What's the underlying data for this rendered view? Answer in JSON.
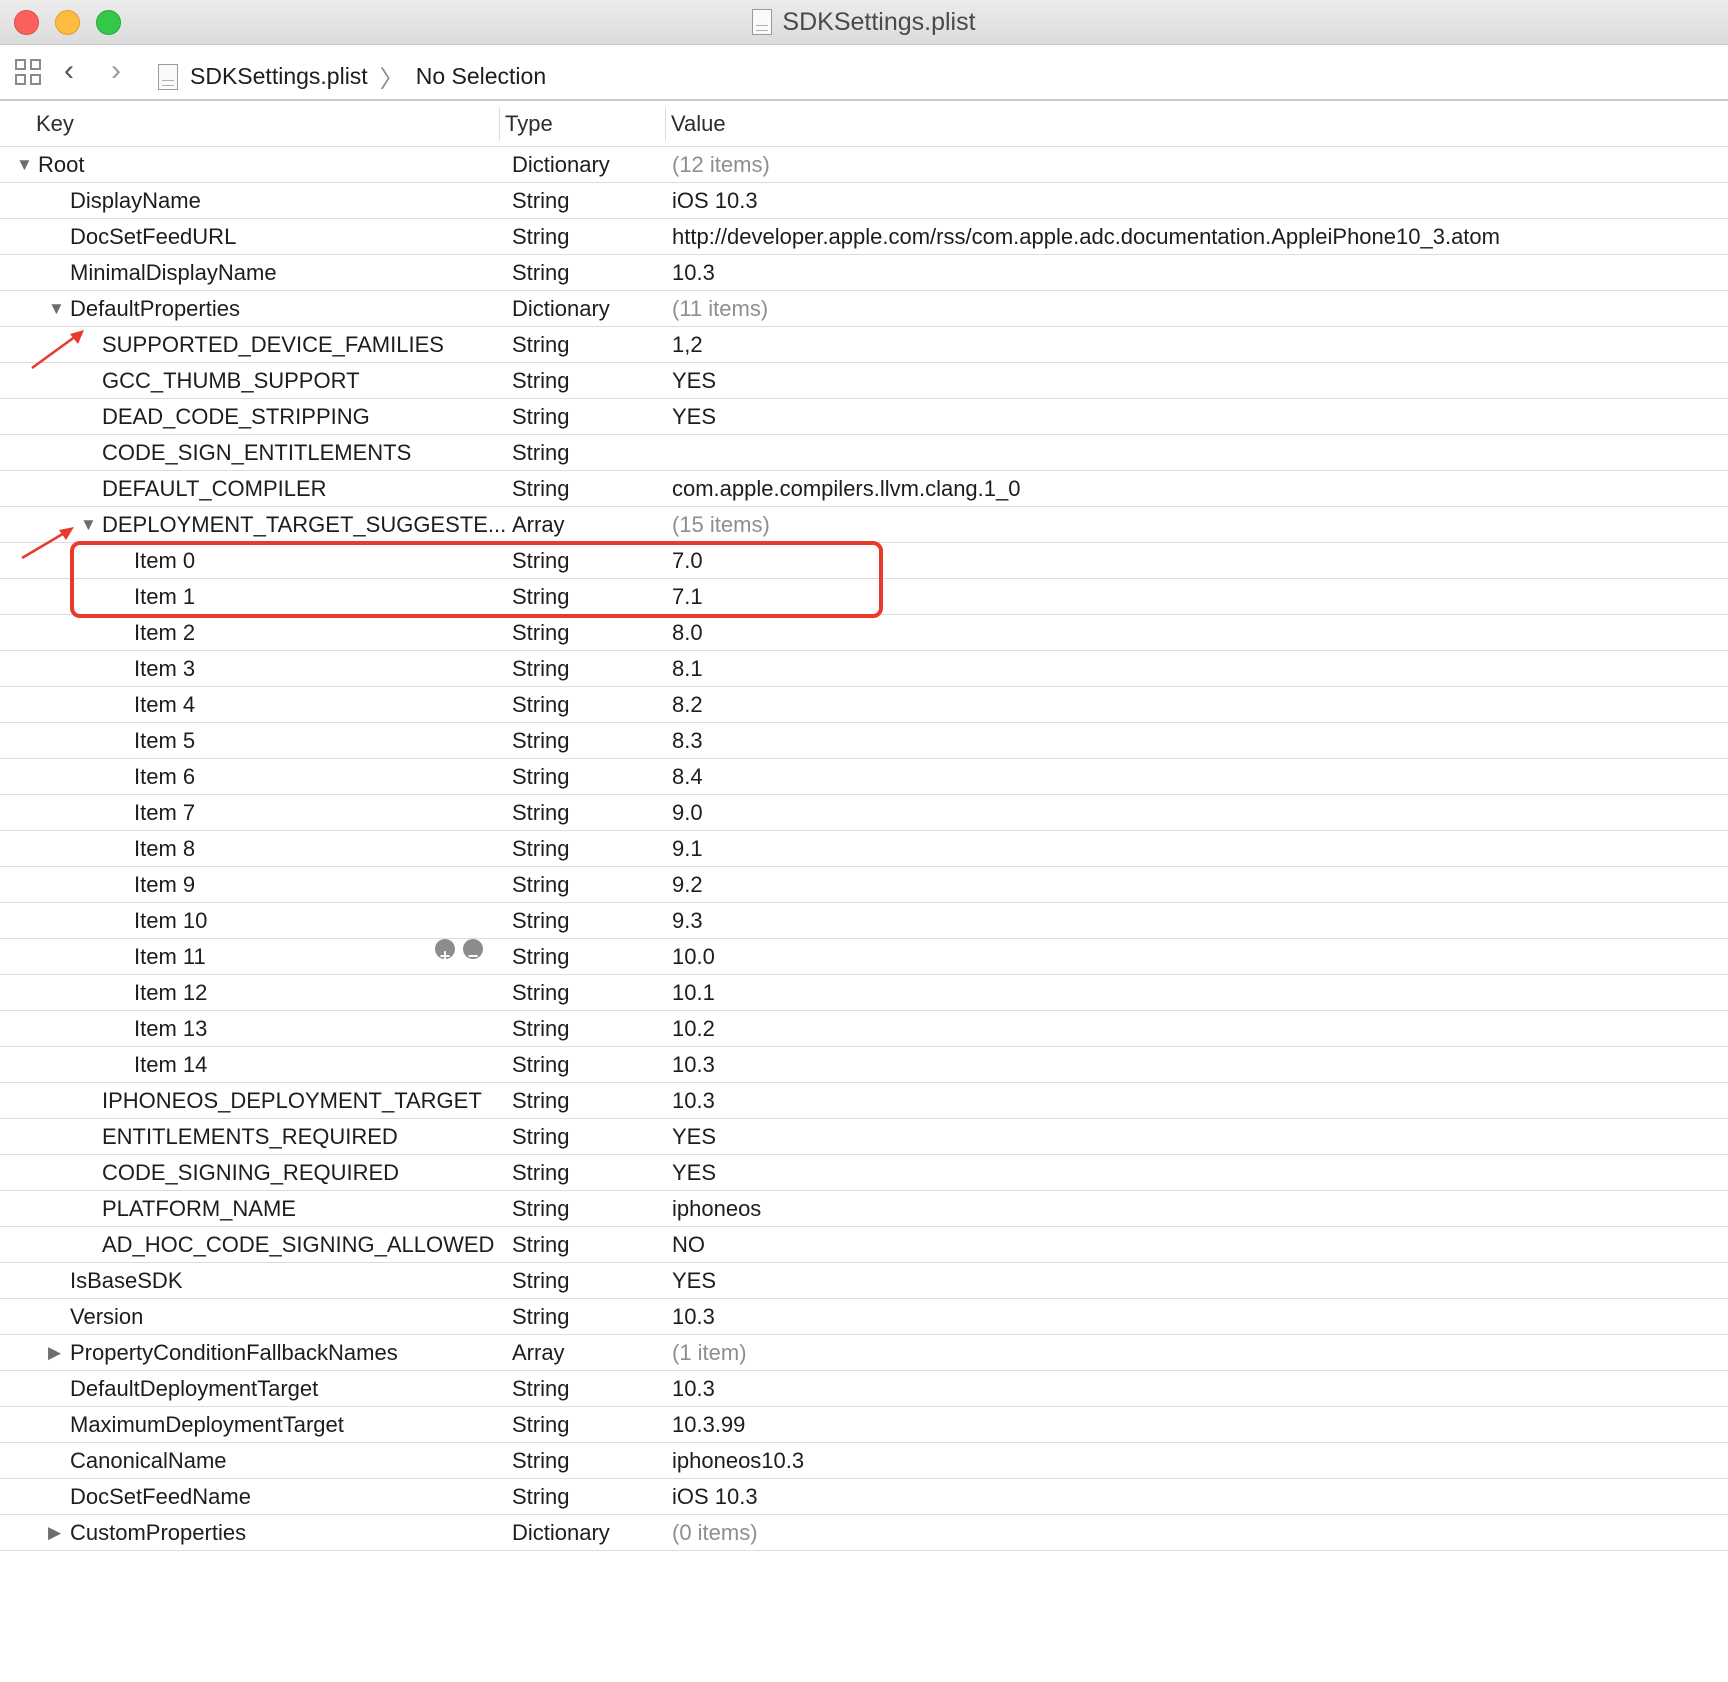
{
  "window": {
    "title": "SDKSettings.plist"
  },
  "jumpbar": {
    "file": "SDKSettings.plist",
    "selection": "No Selection"
  },
  "columns": {
    "key": "Key",
    "type": "Type",
    "value": "Value"
  },
  "colors": {
    "annotation": "#e83a2b",
    "muted_value": "#8e8e8e"
  },
  "rows": [
    {
      "key": "Root",
      "type": "Dictionary",
      "value": "(12 items)",
      "level": 0,
      "disclosure": "expanded",
      "muted": true
    },
    {
      "key": "DisplayName",
      "type": "String",
      "value": "iOS 10.3",
      "level": 1
    },
    {
      "key": "DocSetFeedURL",
      "type": "String",
      "value": "http://developer.apple.com/rss/com.apple.adc.documentation.AppleiPhone10_3.atom",
      "level": 1
    },
    {
      "key": "MinimalDisplayName",
      "type": "String",
      "value": "10.3",
      "level": 1
    },
    {
      "key": "DefaultProperties",
      "type": "Dictionary",
      "value": "(11 items)",
      "level": 1,
      "disclosure": "expanded",
      "muted": true
    },
    {
      "key": "SUPPORTED_DEVICE_FAMILIES",
      "type": "String",
      "value": "1,2",
      "level": 2
    },
    {
      "key": "GCC_THUMB_SUPPORT",
      "type": "String",
      "value": "YES",
      "level": 2
    },
    {
      "key": "DEAD_CODE_STRIPPING",
      "type": "String",
      "value": "YES",
      "level": 2
    },
    {
      "key": "CODE_SIGN_ENTITLEMENTS",
      "type": "String",
      "value": "",
      "level": 2
    },
    {
      "key": "DEFAULT_COMPILER",
      "type": "String",
      "value": "com.apple.compilers.llvm.clang.1_0",
      "level": 2
    },
    {
      "key": "DEPLOYMENT_TARGET_SUGGESTE...",
      "type": "Array",
      "value": "(15 items)",
      "level": 2,
      "disclosure": "expanded",
      "muted": true
    },
    {
      "key": "Item 0",
      "type": "String",
      "value": "7.0",
      "level": 3
    },
    {
      "key": "Item 1",
      "type": "String",
      "value": "7.1",
      "level": 3
    },
    {
      "key": "Item 2",
      "type": "String",
      "value": "8.0",
      "level": 3
    },
    {
      "key": "Item 3",
      "type": "String",
      "value": "8.1",
      "level": 3
    },
    {
      "key": "Item 4",
      "type": "String",
      "value": "8.2",
      "level": 3
    },
    {
      "key": "Item 5",
      "type": "String",
      "value": "8.3",
      "level": 3
    },
    {
      "key": "Item 6",
      "type": "String",
      "value": "8.4",
      "level": 3
    },
    {
      "key": "Item 7",
      "type": "String",
      "value": "9.0",
      "level": 3
    },
    {
      "key": "Item 8",
      "type": "String",
      "value": "9.1",
      "level": 3
    },
    {
      "key": "Item 9",
      "type": "String",
      "value": "9.2",
      "level": 3
    },
    {
      "key": "Item 10",
      "type": "String",
      "value": "9.3",
      "level": 3
    },
    {
      "key": "Item 11",
      "type": "String",
      "value": "10.0",
      "level": 3,
      "hover_controls": true
    },
    {
      "key": "Item 12",
      "type": "String",
      "value": "10.1",
      "level": 3
    },
    {
      "key": "Item 13",
      "type": "String",
      "value": "10.2",
      "level": 3
    },
    {
      "key": "Item 14",
      "type": "String",
      "value": "10.3",
      "level": 3
    },
    {
      "key": "IPHONEOS_DEPLOYMENT_TARGET",
      "type": "String",
      "value": "10.3",
      "level": 2
    },
    {
      "key": "ENTITLEMENTS_REQUIRED",
      "type": "String",
      "value": "YES",
      "level": 2
    },
    {
      "key": "CODE_SIGNING_REQUIRED",
      "type": "String",
      "value": "YES",
      "level": 2
    },
    {
      "key": "PLATFORM_NAME",
      "type": "String",
      "value": "iphoneos",
      "level": 2
    },
    {
      "key": "AD_HOC_CODE_SIGNING_ALLOWED",
      "type": "String",
      "value": "NO",
      "level": 2
    },
    {
      "key": "IsBaseSDK",
      "type": "String",
      "value": "YES",
      "level": 1
    },
    {
      "key": "Version",
      "type": "String",
      "value": "10.3",
      "level": 1
    },
    {
      "key": "PropertyConditionFallbackNames",
      "type": "Array",
      "value": "(1 item)",
      "level": 1,
      "disclosure": "collapsed",
      "muted": true
    },
    {
      "key": "DefaultDeploymentTarget",
      "type": "String",
      "value": "10.3",
      "level": 1
    },
    {
      "key": "MaximumDeploymentTarget",
      "type": "String",
      "value": "10.3.99",
      "level": 1
    },
    {
      "key": "CanonicalName",
      "type": "String",
      "value": "iphoneos10.3",
      "level": 1
    },
    {
      "key": "DocSetFeedName",
      "type": "String",
      "value": "iOS 10.3",
      "level": 1
    },
    {
      "key": "CustomProperties",
      "type": "Dictionary",
      "value": "(0 items)",
      "level": 1,
      "disclosure": "collapsed",
      "muted": true
    }
  ]
}
